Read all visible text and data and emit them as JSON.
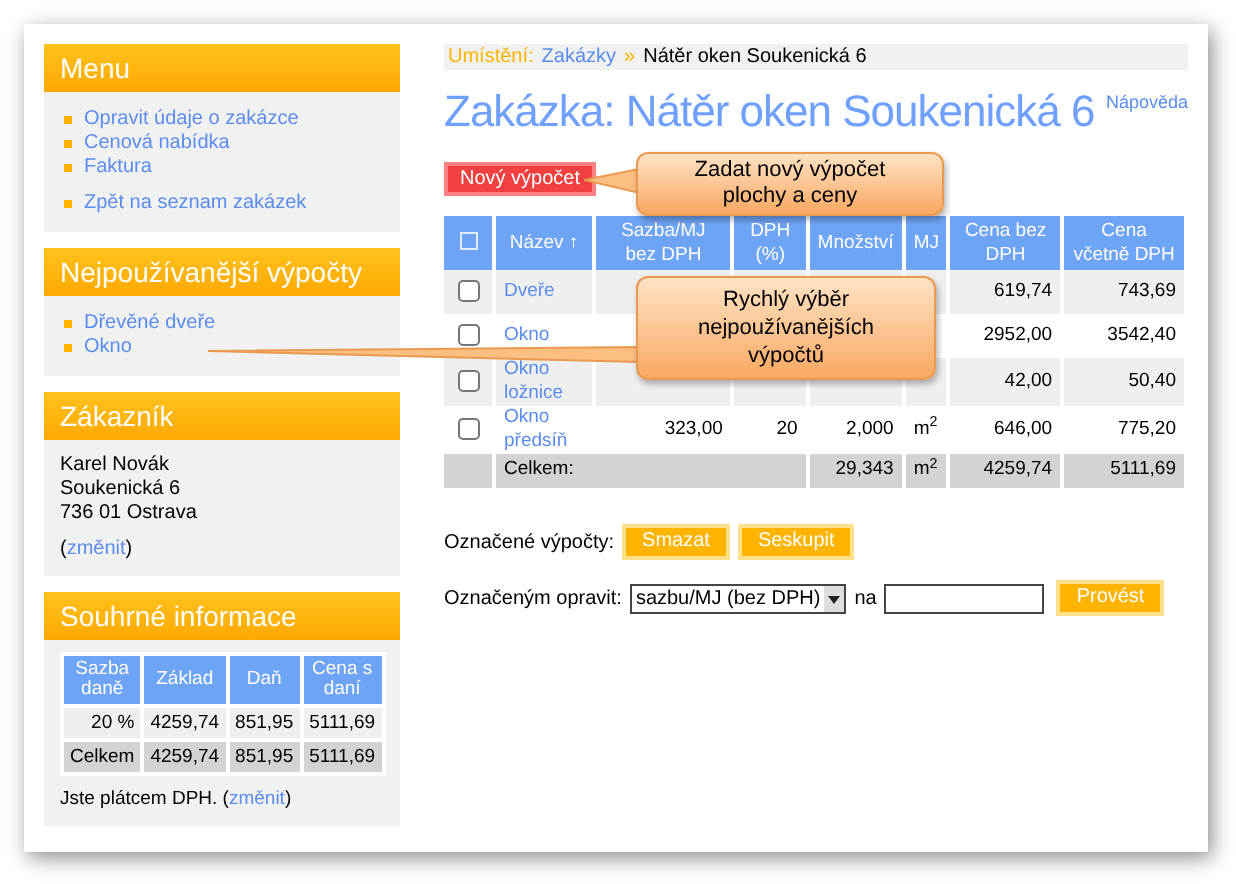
{
  "sidebar": {
    "menu": {
      "title": "Menu",
      "groups": [
        [
          "Opravit údaje o zakázce",
          "Cenová nabídka",
          "Faktura"
        ],
        [
          "Zpět na seznam zakázek"
        ]
      ]
    },
    "frequent": {
      "title": "Nejpoužívanější výpočty",
      "groups": [
        [
          "Dřevěné dveře",
          "Okno"
        ]
      ]
    },
    "customer": {
      "title": "Zákazník",
      "lines": [
        "Karel Novák",
        "Soukenická 6",
        "736 01 Ostrava"
      ],
      "before": "(",
      "link": "změnit",
      "after": ")"
    },
    "summary": {
      "title": "Souhrné informace",
      "columns": [
        "Sazba daně",
        "Základ",
        "Daň",
        "Cena s daní"
      ],
      "rows": [
        {
          "kind": "rate",
          "cells": [
            "20 %",
            "4259,74",
            "851,95",
            "5111,69"
          ]
        },
        {
          "kind": "total",
          "cells": [
            "Celkem",
            "4259,74",
            "851,95",
            "5111,69"
          ]
        }
      ],
      "note": {
        "before": "Jste plátcem DPH. (",
        "link": "změnit",
        "after": ")"
      }
    }
  },
  "breadcrumb": {
    "label": "Umístění:",
    "link": "Zakázky",
    "separator": "»",
    "current": "Nátěr oken Soukenická 6"
  },
  "title": "Zakázka: Nátěr oken Soukenická 6",
  "help": "Nápověda",
  "new_button": "Nový výpočet",
  "table": {
    "columns": [
      "Název ↑",
      "Sazba/MJ bez DPH",
      "DPH (%)",
      "Množství",
      "MJ",
      "Cena bez DPH",
      "Cena včetně DPH"
    ],
    "rows": [
      {
        "checked": false,
        "name": "Dveře",
        "price": "619,74",
        "total": "743,69"
      },
      {
        "checked": false,
        "name": "Okno",
        "price": "2952,00",
        "total": "3542,40"
      },
      {
        "checked": false,
        "name": "Okno ložnice",
        "price": "42,00",
        "total": "50,40"
      },
      {
        "checked": false,
        "name": "Okno předsíň",
        "rate": "323,00",
        "vat": "20",
        "qty": "2,000",
        "unit": "m$^{2}$",
        "price": "646,00",
        "total": "775,20"
      }
    ],
    "sum": {
      "label": "Celkem:",
      "qty": "29,343",
      "unit": "m$^{2}$",
      "price": "4259,74",
      "total": "5111,69"
    }
  },
  "selected_actions": {
    "label": "Označené výpočty:",
    "buttons": [
      "Smazat",
      "Seskupit"
    ]
  },
  "bulk_edit": {
    "label": "Označeným opravit:",
    "select": "sazbu/MJ (bez DPH)",
    "to": "na",
    "button": "Provést"
  },
  "callouts": [
    "Zadat nový výpočet plochy a ceny",
    "Rychlý výběr nejpoužívanějších výpočtů"
  ]
}
